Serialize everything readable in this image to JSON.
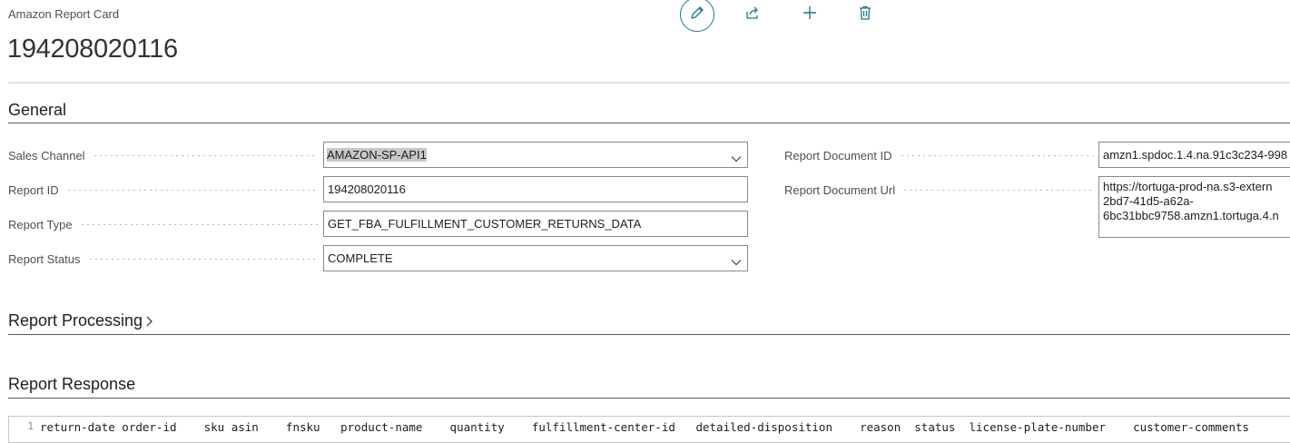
{
  "header": {
    "caption": "Amazon Report Card",
    "title": "194208020116",
    "actions": [
      {
        "name": "edit",
        "icon": "pencil-icon"
      },
      {
        "name": "share",
        "icon": "share-icon"
      },
      {
        "name": "new",
        "icon": "plus-icon"
      },
      {
        "name": "delete",
        "icon": "trash-icon"
      }
    ]
  },
  "general": {
    "title": "General",
    "sales_channel": {
      "label": "Sales Channel",
      "value": "AMAZON-SP-API1"
    },
    "report_id": {
      "label": "Report ID",
      "value": "194208020116"
    },
    "report_type": {
      "label": "Report Type",
      "value": "GET_FBA_FULFILLMENT_CUSTOMER_RETURNS_DATA"
    },
    "report_status": {
      "label": "Report Status",
      "value": "COMPLETE"
    },
    "report_document_id": {
      "label": "Report Document ID",
      "value": "amzn1.spdoc.1.4.na.91c3c234-998"
    },
    "report_document_url": {
      "label": "Report Document Url",
      "value": "https://tortuga-prod-na.s3-extern 2bd7-41d5-a62a-6bc31bbc9758.amzn1.tortuga.4.n"
    }
  },
  "report_processing": {
    "title": "Report Processing"
  },
  "report_response": {
    "title": "Report Response",
    "line_number": "1",
    "first_line": "return-date order-id    sku asin    fnsku   product-name    quantity    fulfillment-center-id   detailed-disposition    reason  status  license-plate-number    customer-comments"
  },
  "colors": {
    "accent": "#1b7a8b",
    "divider": "#505a62",
    "selection": "#c8c8c8"
  }
}
